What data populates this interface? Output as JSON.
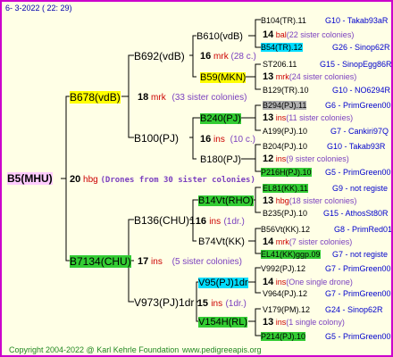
{
  "header_date": "6-  3-2022 ( 22:  29)",
  "footer_copyright": "Copyright 2004-2022 @ Karl Kehrle Foundation",
  "footer_url": "www.pedigreeapis.org",
  "root": {
    "name": "B5(MHU)",
    "num": "20",
    "code": "hbg",
    "note": "(Drones from 30 sister colonies)"
  },
  "gen1": [
    {
      "name": "B678(vdB)",
      "num": "18",
      "code": "mrk",
      "note": "(33 sister colonies)"
    },
    {
      "name": "B7134(CHU)",
      "num": "17",
      "code": "ins",
      "note": "(5 sister colonies)"
    }
  ],
  "gen2": [
    {
      "name": "B692(vdB)"
    },
    {
      "name": "B100(PJ)",
      "num": "16",
      "code": "ins",
      "note": "(10 c.)"
    },
    {
      "name": "B136(CHU)1",
      "num": "16",
      "code": "ins",
      "note": "(1dr.)"
    },
    {
      "name": "V973(PJ)1dr",
      "num": "15",
      "code": "ins",
      "note": "(1dr.)"
    }
  ],
  "gen3": [
    {
      "name": "B610(vdB)",
      "num": "16",
      "code": "mrk",
      "note": "(28 c.)"
    },
    {
      "name": "B59(MKN)"
    },
    {
      "name": "B240(PJ)"
    },
    {
      "name": "B180(PJ)"
    },
    {
      "name": "B14Vt(RHO)"
    },
    {
      "name": "B74Vt(KK)"
    },
    {
      "name": "V95(PJ)1dr"
    },
    {
      "name": "V154H(RL)"
    }
  ],
  "gen4": [
    {
      "name": "B104(TR).11",
      "right": "G10 - Takab93aR"
    },
    {
      "num": "14",
      "code": "bal",
      "note": "(22 sister colonies)"
    },
    {
      "name": "B54(TR).12",
      "right": "G26 - Sinop62R"
    },
    {
      "name": "ST206.11",
      "right": "G15 - SinopEgg86R"
    },
    {
      "num": "13",
      "code": "mrk",
      "note": "(24 sister colonies)"
    },
    {
      "name": "B129(TR).10",
      "right": "G10 - NO6294R"
    },
    {
      "name": "B294(PJ).11",
      "right": "G6 - PrimGreen00"
    },
    {
      "num": "13",
      "code": "ins",
      "note": "(11 sister colonies)"
    },
    {
      "name": "A199(PJ).10",
      "right": "G7 - Cankiri97Q"
    },
    {
      "name": "B204(PJ).10",
      "right": "G10 - Takab93R"
    },
    {
      "num": "12",
      "code": "ins",
      "note": "(9 sister colonies)"
    },
    {
      "name": "P216H(PJ).10",
      "right": "G5 - PrimGreen00"
    },
    {
      "name": "EL81(KK).11",
      "right": "G9 - not registe"
    },
    {
      "num": "13",
      "code": "hbg",
      "note": "(18 sister colonies)"
    },
    {
      "name": "B235(PJ).10",
      "right": "G15 - AthosSt80R"
    },
    {
      "name": "B56Vt(KK).12",
      "right": "G8 - PrimRed01"
    },
    {
      "num": "14",
      "code": "mrk",
      "note": "(7 sister colonies)"
    },
    {
      "name": "EL41(KK)ggp.09",
      "right": "G7 - not registe"
    },
    {
      "name": "V992(PJ).12",
      "right": "G7 - PrimGreen00"
    },
    {
      "num": "14",
      "code": "ins",
      "note": "(One single drone)"
    },
    {
      "name": "V964(PJ).12",
      "right": "G7 - PrimGreen00"
    },
    {
      "name": "V179(PM).12",
      "right": "G24 - Sinop62R"
    },
    {
      "num": "13",
      "code": "ins",
      "note": "(1 single colony)"
    },
    {
      "name": "P214(PJ).10",
      "right": "G5 - PrimGreen00"
    }
  ]
}
